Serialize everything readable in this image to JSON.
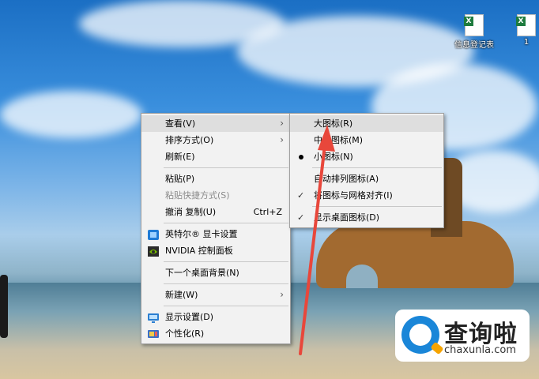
{
  "desktop": {
    "icons": [
      {
        "label": "信息登记表"
      },
      {
        "label": "1"
      }
    ]
  },
  "context_menu": {
    "items": [
      {
        "label": "查看(V)",
        "submenu": true
      },
      {
        "label": "排序方式(O)",
        "submenu": true
      },
      {
        "label": "刷新(E)"
      },
      {
        "label": "粘贴(P)"
      },
      {
        "label": "粘贴快捷方式(S)",
        "disabled": true
      },
      {
        "label": "撤消 复制(U)",
        "shortcut": "Ctrl+Z"
      },
      {
        "label": "英特尔® 显卡设置",
        "icon": "intel-graphics-icon"
      },
      {
        "label": "NVIDIA 控制面板",
        "icon": "nvidia-icon"
      },
      {
        "label": "下一个桌面背景(N)"
      },
      {
        "label": "新建(W)",
        "submenu": true
      },
      {
        "label": "显示设置(D)",
        "icon": "display-settings-icon"
      },
      {
        "label": "个性化(R)",
        "icon": "personalize-icon"
      }
    ]
  },
  "view_submenu": {
    "items": [
      {
        "label": "大图标(R)"
      },
      {
        "label": "中等图标(M)"
      },
      {
        "label": "小图标(N)",
        "selected": true
      },
      {
        "label": "自动排列图标(A)"
      },
      {
        "label": "将图标与网格对齐(I)",
        "checked": true
      },
      {
        "label": "显示桌面图标(D)",
        "checked": true
      }
    ]
  },
  "watermark": {
    "name": "查询啦",
    "url": "chaxunla.com"
  },
  "colors": {
    "menu_bg": "#f2f2f2",
    "highlight": "#dedede",
    "annotation_arrow": "#e8473b"
  }
}
